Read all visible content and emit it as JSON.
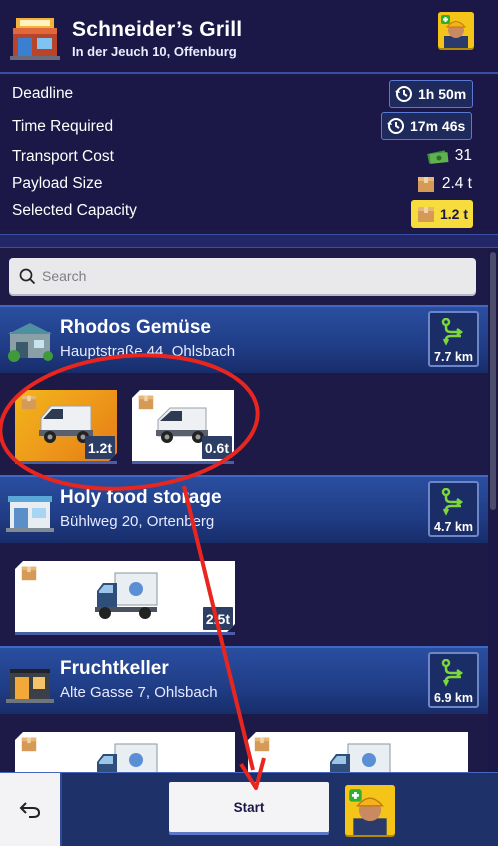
{
  "header": {
    "title": "Schneider’s Grill",
    "address": "In der Jeuch 10, Offenburg"
  },
  "info": {
    "deadline_label": "Deadline",
    "deadline_value": "1h 50m",
    "time_required_label": "Time Required",
    "time_required_value": "17m 46s",
    "transport_cost_label": "Transport Cost",
    "transport_cost_value": "31",
    "payload_size_label": "Payload Size",
    "payload_size_value": "2.4 t",
    "selected_capacity_label": "Selected Capacity",
    "selected_capacity_value": "1.2 t"
  },
  "search": {
    "placeholder": "Search"
  },
  "stores": [
    {
      "name": "Rhodos Gemüse",
      "address": "Hauptstraße 44, Ohlsbach",
      "distance": "7.7 km",
      "vehicles": [
        {
          "capacity": "1.2t",
          "type": "van",
          "selected": true
        },
        {
          "capacity": "0.6t",
          "type": "van",
          "selected": false
        }
      ]
    },
    {
      "name": "Holy food storage",
      "address": "Bühlweg 20, Ortenberg",
      "distance": "4.7 km",
      "vehicles": [
        {
          "capacity": "2.5t",
          "type": "box-truck",
          "selected": false
        }
      ]
    },
    {
      "name": "Fruchtkeller",
      "address": "Alte Gasse 7, Ohlsbach",
      "distance": "6.9 km",
      "vehicles": [
        {
          "capacity": "",
          "type": "box-truck",
          "selected": false
        },
        {
          "capacity": "",
          "type": "box-truck",
          "selected": false
        }
      ]
    }
  ],
  "bottom": {
    "start_label": "Start"
  },
  "colors": {
    "background": "#1d1a48",
    "store_header": "#2a4ea0",
    "selected_vehicle": "#f2b619",
    "capacity_pill": "#f6dc3c",
    "annotation": "#e8261f",
    "route_icon": "#7dd63c"
  },
  "icons": [
    "restaurant-building-icon",
    "worker-avatar-icon",
    "clock-refresh-icon",
    "cash-icon",
    "package-box-icon",
    "search-icon",
    "warehouse-icon",
    "route-icon",
    "van-icon",
    "box-truck-icon",
    "back-arrow-icon"
  ]
}
